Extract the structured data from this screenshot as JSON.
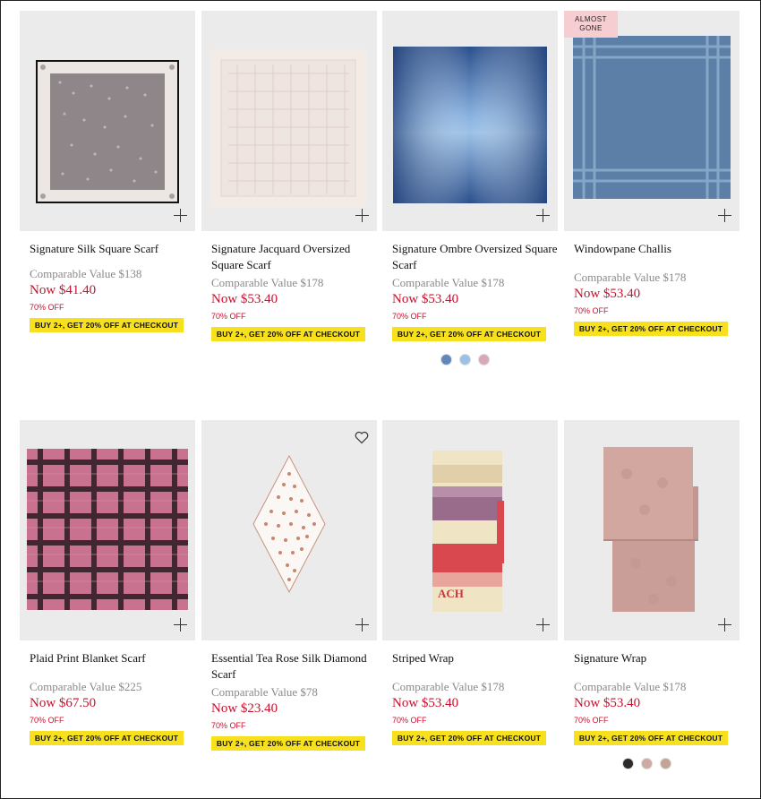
{
  "products": [
    {
      "name": "Signature Silk Square Scarf",
      "comparable": "Comparable Value $138",
      "now": "Now $41.40",
      "off": "70% OFF",
      "promo": "BUY 2+, GET 20% OFF AT CHECKOUT"
    },
    {
      "name": "Signature Jacquard Oversized Square Scarf",
      "comparable": "Comparable Value $178",
      "now": "Now $53.40",
      "off": "70% OFF",
      "promo": "BUY 2+, GET 20% OFF AT CHECKOUT"
    },
    {
      "name": "Signature Ombre Oversized Square Scarf",
      "comparable": "Comparable Value $178",
      "now": "Now $53.40",
      "off": "70% OFF",
      "promo": "BUY 2+, GET 20% OFF AT CHECKOUT",
      "swatches": [
        "#5f87b8",
        "#9cc1e6",
        "#d9a8b4"
      ]
    },
    {
      "name": "Windowpane Challis",
      "badge": "ALMOST GONE",
      "comparable": "Comparable Value $178",
      "now": "Now $53.40",
      "off": "70% OFF",
      "promo": "BUY 2+, GET 20% OFF AT CHECKOUT"
    },
    {
      "name": "Plaid Print Blanket Scarf",
      "comparable": "Comparable Value $225",
      "now": "Now $67.50",
      "off": "70% OFF",
      "promo": "BUY 2+, GET 20% OFF AT CHECKOUT"
    },
    {
      "name": "Essential Tea Rose Silk Diamond Scarf",
      "comparable": "Comparable Value $78",
      "now": "Now $23.40",
      "off": "70% OFF",
      "promo": "BUY 2+, GET 20% OFF AT CHECKOUT"
    },
    {
      "name": "Striped Wrap",
      "comparable": "Comparable Value $178",
      "now": "Now $53.40",
      "off": "70% OFF",
      "promo": "BUY 2+, GET 20% OFF AT CHECKOUT"
    },
    {
      "name": "Signature Wrap",
      "comparable": "Comparable Value $178",
      "now": "Now $53.40",
      "off": "70% OFF",
      "promo": "BUY 2+, GET 20% OFF AT CHECKOUT",
      "swatches": [
        "#2b2b2b",
        "#cfaaa2",
        "#c4a595"
      ]
    }
  ],
  "colors": {
    "price_red": "#c8102e",
    "promo_yellow": "#f7e01d",
    "badge_pink": "#f6cdd1"
  },
  "icons": {
    "add": "plus-icon",
    "wishlist": "heart-icon"
  }
}
